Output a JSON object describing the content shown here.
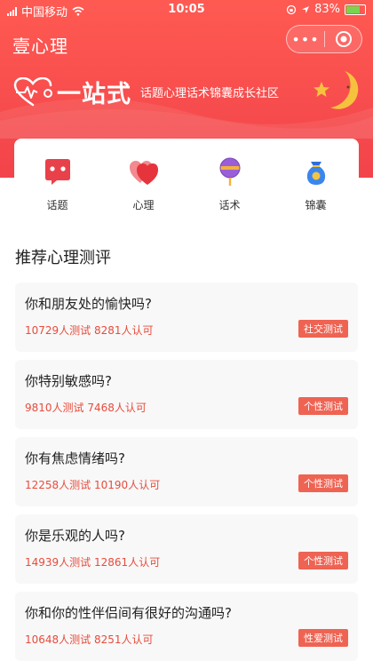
{
  "status_bar": {
    "carrier": "中国移动",
    "time": "10:05",
    "battery": "83%",
    "battery_fraction": 0.83
  },
  "header": {
    "title": "壹心理",
    "slogan_big": "一站式",
    "slogan_small": "话题心理话术锦囊成长社区"
  },
  "categories": [
    {
      "label": "话题",
      "icon": "chat-bubble-icon"
    },
    {
      "label": "心理",
      "icon": "hearts-icon"
    },
    {
      "label": "话术",
      "icon": "lollipop-icon"
    },
    {
      "label": "锦囊",
      "icon": "pouch-icon"
    }
  ],
  "section": {
    "title": "推荐心理测评"
  },
  "tests": [
    {
      "question": "你和朋友处的愉快吗?",
      "testers": "10729人测试",
      "approvals": "8281人认可",
      "tag": "社交测试"
    },
    {
      "question": "你特别敏感吗?",
      "testers": "9810人测试",
      "approvals": "7468人认可",
      "tag": "个性测试"
    },
    {
      "question": "你有焦虑情绪吗?",
      "testers": "12258人测试",
      "approvals": "10190人认可",
      "tag": "个性测试"
    },
    {
      "question": "你是乐观的人吗?",
      "testers": "14939人测试",
      "approvals": "12861人认可",
      "tag": "个性测试"
    },
    {
      "question": "你和你的性伴侣间有很好的沟通吗?",
      "testers": "10648人测试",
      "approvals": "8251人认可",
      "tag": "性爱测试"
    }
  ],
  "colors": {
    "brand": "#f2434a",
    "tag": "#ef6353",
    "stats": "#e74c3c"
  }
}
